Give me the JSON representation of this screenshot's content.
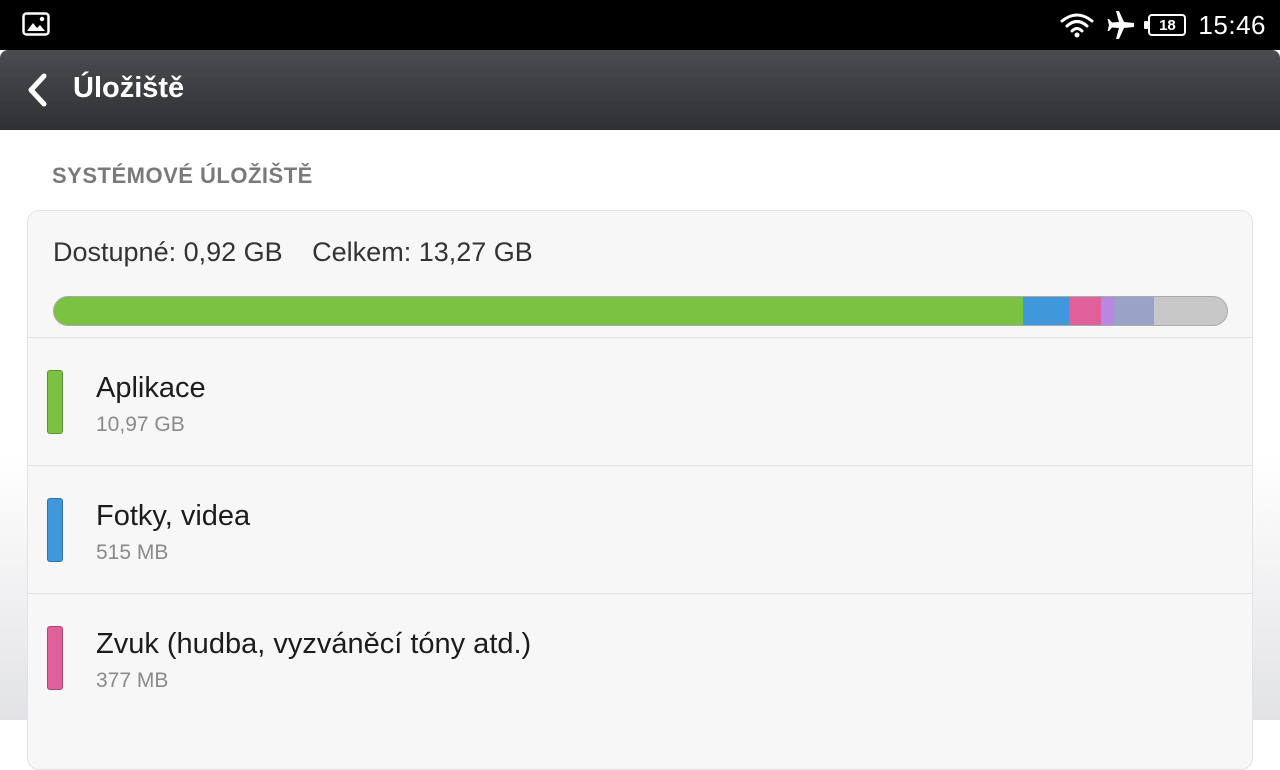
{
  "status_bar": {
    "left_icon": "gallery-icon",
    "icons": [
      "wifi-icon",
      "airplane-icon",
      "battery-icon"
    ],
    "battery_level": "18",
    "time": "15:46"
  },
  "action_bar": {
    "back_icon": "back-arrow-icon",
    "title": "Úložiště"
  },
  "storage": {
    "section_title": "SYSTÉMOVÉ ÚLOŽIŠTĚ",
    "available": "Dostupné: 0,92 GB",
    "total": "Celkem: 13,27 GB",
    "usage_bar": [
      {
        "name": "apps",
        "color": "#7cc242",
        "fraction": 0.826
      },
      {
        "name": "photos",
        "color": "#3f98dc",
        "fraction": 0.039
      },
      {
        "name": "audio",
        "color": "#e0609a",
        "fraction": 0.028
      },
      {
        "name": "other1",
        "color": "#b788e0",
        "fraction": 0.011
      },
      {
        "name": "other2",
        "color": "#9aa2c8",
        "fraction": 0.034
      }
    ],
    "items": [
      {
        "label": "Aplikace",
        "size": "10,97 GB",
        "color": "#7cc242"
      },
      {
        "label": "Fotky, videa",
        "size": "515 MB",
        "color": "#3f98dc"
      },
      {
        "label": "Zvuk (hudba, vyzváněcí tóny atd.)",
        "size": "377 MB",
        "color": "#e0609a"
      }
    ]
  }
}
